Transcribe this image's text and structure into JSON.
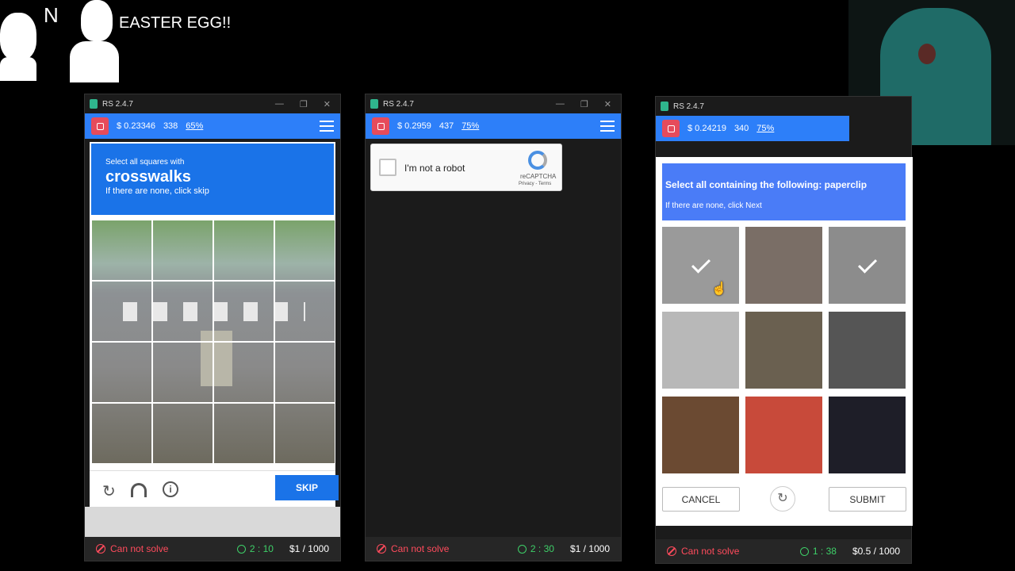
{
  "meme": {
    "label": "EASTER EGG!!",
    "letter": "N"
  },
  "windows": [
    {
      "title": "RS 2.4.7",
      "balance": "$ 0.23346",
      "count": "338",
      "percent": "65%",
      "status": "Can not solve",
      "timer": "2 : 10",
      "price": "$1 / 1000"
    },
    {
      "title": "RS 2.4.7",
      "balance": "$ 0.2959",
      "count": "437",
      "percent": "75%",
      "status": "Can not solve",
      "timer": "2 : 30",
      "price": "$1 / 1000"
    },
    {
      "title": "RS 2.4.7",
      "balance": "$ 0.24219",
      "count": "340",
      "percent": "75%",
      "status": "Can not solve",
      "timer": "1 : 38",
      "price": "$0.5 / 1000"
    }
  ],
  "recaptcha_grid": {
    "prompt_small": "Select all squares with",
    "prompt_big": "crosswalks",
    "prompt_hint": "If there are none, click skip",
    "skip_label": "SKIP"
  },
  "recaptcha_checkbox": {
    "label": "I'm not a robot",
    "brand": "reCAPTCHA",
    "links": "Privacy - Terms"
  },
  "hcaptcha": {
    "prompt": "Select all containing the following: paperclip",
    "hint": "If there are none, click Next",
    "cancel_label": "CANCEL",
    "submit_label": "SUBMIT",
    "tiles": [
      {
        "name": "paperclip-red-selected",
        "color": "#9a9a9a",
        "selected": true
      },
      {
        "name": "paperclip-metal",
        "color": "#7a6e66",
        "selected": false
      },
      {
        "name": "paperclip-red2-selected",
        "color": "#8c8c8c",
        "selected": true
      },
      {
        "name": "paperclip-silver",
        "color": "#b8b8b8",
        "selected": false
      },
      {
        "name": "guitarist",
        "color": "#6a6050",
        "selected": false
      },
      {
        "name": "paperclip-ruler",
        "color": "#555555",
        "selected": false
      },
      {
        "name": "saddle",
        "color": "#6b4a32",
        "selected": false
      },
      {
        "name": "tomatoes",
        "color": "#c84a3a",
        "selected": false
      },
      {
        "name": "paperclips-colorful",
        "color": "#1e1e28",
        "selected": false
      }
    ]
  }
}
